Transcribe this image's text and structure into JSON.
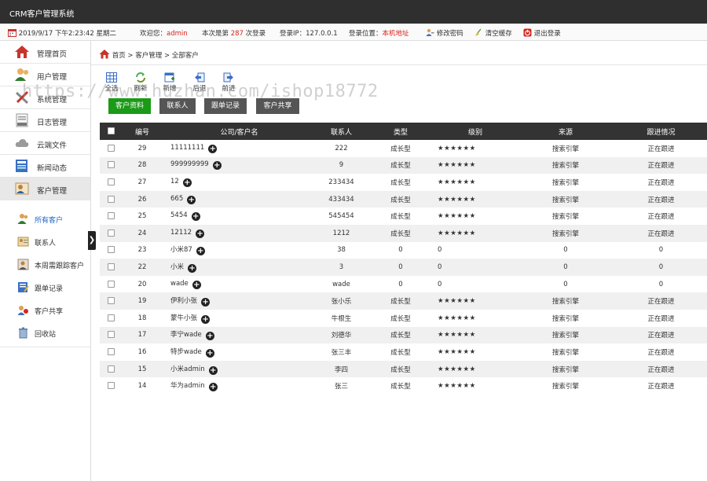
{
  "app": {
    "title": "CRM客户管理系统"
  },
  "infobar": {
    "datetime": "2019/9/17 下午2:23:42 星期二",
    "welcome_label": "欢迎您：",
    "username": "admin",
    "login_count_prefix": "本次是第 ",
    "login_count": "287",
    "login_count_suffix": " 次登录",
    "ip_label": "登录IP：",
    "ip": "127.0.0.1",
    "location_label": "登录位置：",
    "location": "本机地址",
    "change_password": "修改密码",
    "clear_cache": "清空缓存",
    "logout": "退出登录"
  },
  "sidebar": {
    "items": [
      {
        "label": "管理首页",
        "icon": "home-icon"
      },
      {
        "label": "用户管理",
        "icon": "users-icon"
      },
      {
        "label": "系统管理",
        "icon": "tools-icon"
      },
      {
        "label": "日志管理",
        "icon": "log-icon"
      },
      {
        "label": "云端文件",
        "icon": "cloud-icon"
      },
      {
        "label": "新闻动态",
        "icon": "news-icon"
      },
      {
        "label": "客户管理",
        "icon": "customer-icon",
        "active": true
      }
    ],
    "sub_items": [
      {
        "label": "所有客户",
        "icon": "all-customers-icon",
        "active": true
      },
      {
        "label": "联系人",
        "icon": "contact-icon"
      },
      {
        "label": "本周需跟踪客户",
        "icon": "track-icon"
      },
      {
        "label": "跟单记录",
        "icon": "record-icon"
      },
      {
        "label": "客户共享",
        "icon": "share-icon"
      },
      {
        "label": "回收站",
        "icon": "recycle-icon"
      }
    ]
  },
  "breadcrumb": {
    "home": "首页",
    "sep1": " > ",
    "section": "客户管理",
    "sep2": " > ",
    "page": "全部客户"
  },
  "toolbar": {
    "select_all": "全选",
    "refresh": "刷新",
    "new": "新增",
    "back": "后退",
    "forward": "前进"
  },
  "tabs": [
    "客户资料",
    "联系人",
    "跟单记录",
    "客户共享"
  ],
  "watermark": "https://www.huzhan.com/ishop18772",
  "table": {
    "headers": [
      "编号",
      "公司/客户名",
      "联系人",
      "类型",
      "级别",
      "来源",
      "跟进情况"
    ],
    "rows": [
      {
        "id": "29",
        "name": "11111111",
        "contact": "222",
        "type": "成长型",
        "level": "★★★★★★",
        "source": "搜索引擎",
        "status": "正在跟进"
      },
      {
        "id": "28",
        "name": "999999999",
        "contact": "9",
        "type": "成长型",
        "level": "★★★★★★",
        "source": "搜索引擎",
        "status": "正在跟进"
      },
      {
        "id": "27",
        "name": "12",
        "contact": "233434",
        "type": "成长型",
        "level": "★★★★★★",
        "source": "搜索引擎",
        "status": "正在跟进"
      },
      {
        "id": "26",
        "name": "665",
        "contact": "433434",
        "type": "成长型",
        "level": "★★★★★★",
        "source": "搜索引擎",
        "status": "正在跟进"
      },
      {
        "id": "25",
        "name": "5454",
        "contact": "545454",
        "type": "成长型",
        "level": "★★★★★★",
        "source": "搜索引擎",
        "status": "正在跟进"
      },
      {
        "id": "24",
        "name": "12112",
        "contact": "1212",
        "type": "成长型",
        "level": "★★★★★★",
        "source": "搜索引擎",
        "status": "正在跟进"
      },
      {
        "id": "23",
        "name": "小米87",
        "contact": "38",
        "type": "0",
        "level": "0",
        "source": "0",
        "status": "0"
      },
      {
        "id": "22",
        "name": "小米",
        "contact": "3",
        "type": "0",
        "level": "0",
        "source": "0",
        "status": "0"
      },
      {
        "id": "20",
        "name": "wade",
        "contact": "wade",
        "type": "0",
        "level": "0",
        "source": "0",
        "status": "0"
      },
      {
        "id": "19",
        "name": "伊利小张",
        "contact": "张小乐",
        "type": "成长型",
        "level": "★★★★★★",
        "source": "搜索引擎",
        "status": "正在跟进"
      },
      {
        "id": "18",
        "name": "蒙牛小张",
        "contact": "牛根生",
        "type": "成长型",
        "level": "★★★★★★",
        "source": "搜索引擎",
        "status": "正在跟进"
      },
      {
        "id": "17",
        "name": "李宁wade",
        "contact": "刘德华",
        "type": "成长型",
        "level": "★★★★★★",
        "source": "搜索引擎",
        "status": "正在跟进"
      },
      {
        "id": "16",
        "name": "特步wade",
        "contact": "张三丰",
        "type": "成长型",
        "level": "★★★★★★",
        "source": "搜索引擎",
        "status": "正在跟进"
      },
      {
        "id": "15",
        "name": "小米admin",
        "contact": "李四",
        "type": "成长型",
        "level": "★★★★★★",
        "source": "搜索引擎",
        "status": "正在跟进"
      },
      {
        "id": "14",
        "name": "华为admin",
        "contact": "张三",
        "type": "成长型",
        "level": "★★★★★★",
        "source": "搜索引擎",
        "status": "正在跟进"
      }
    ]
  },
  "colors": {
    "titlebar": "#2f2f2f",
    "active_tab": "#1a9a17",
    "tab": "#555555",
    "header": "#333333",
    "highlight": "#d9241b",
    "sub_active": "#1f63c6"
  }
}
